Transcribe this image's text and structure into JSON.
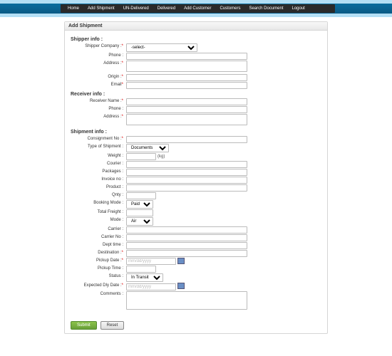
{
  "nav": {
    "home": "Home",
    "add_shipment": "Add Shipment",
    "undelivered": "UN-Delivered",
    "delivered": "Delivered",
    "add_customer": "Add Customer",
    "customers": "Customers",
    "search": "Search Document",
    "logout": "Logout"
  },
  "panel": {
    "title": "Add Shipment"
  },
  "sections": {
    "shipper": "Shipper info :",
    "receiver": "Receiver info :",
    "shipment": "Shipment info :"
  },
  "labels": {
    "shipper_company": "Shipper Company :",
    "phone": "Phone :",
    "address": "Address :",
    "origin": "Origin :",
    "email": "Email",
    "receiver_name": "Receiver Name :",
    "consignment": "Consignment No :",
    "type_shipment": "Type of Shipment :",
    "weight": "Weight :",
    "courier": "Courier :",
    "packages": "Packages :",
    "invoice": "Invoice no :",
    "product": "Product :",
    "qnty": "Qnty :",
    "booking_mode": "Booking Mode :",
    "total_freight": "Total Freight :",
    "mode": "Mode :",
    "carrier": "Carrier :",
    "carrier_no": "Carrier No :",
    "dept_time": "Dept time :",
    "destination": "Destination :",
    "pickup_date": "Pickup Date :",
    "pickup_time": "Pickup Time :",
    "status": "Status :",
    "expected_dly": "Expected Dly Date :",
    "comments": "Comments :"
  },
  "req": "*",
  "values": {
    "select_placeholder": "-select-",
    "type_shipment": "Documents",
    "booking_mode": "Paid",
    "mode": "Air",
    "status": "In Transit",
    "weight_unit": "(kg)",
    "date_placeholder": "mm/dd/yyyy"
  },
  "buttons": {
    "submit": "Submit",
    "reset": "Reset"
  }
}
